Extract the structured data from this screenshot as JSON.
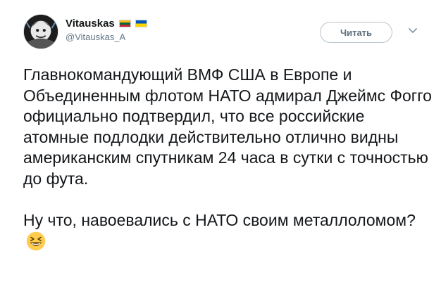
{
  "author": {
    "display_name": "Vitauskas",
    "handle": "@Vitauskas_A",
    "flags": [
      "lithuania-flag-icon",
      "ukraine-flag-icon"
    ]
  },
  "actions": {
    "follow_label": "Читать",
    "more_icon": "chevron-down-icon"
  },
  "tweet": {
    "paragraph1": "Главнокомандующий ВМФ США в Европе и Объединенным флотом НАТО адмирал Джеймс Фогго официально подтвердил, что все российские атомные подлодки действительно отлично видны американским спутникам 24 часа в сутки с точностью до фута.",
    "paragraph2": "Ну что, навоевались с НАТО своим металлоломом?",
    "emoji": "grinning-squinting-face-icon"
  },
  "colors": {
    "text": "#14171a",
    "secondary": "#657786",
    "button_border": "#b8c3cc"
  }
}
